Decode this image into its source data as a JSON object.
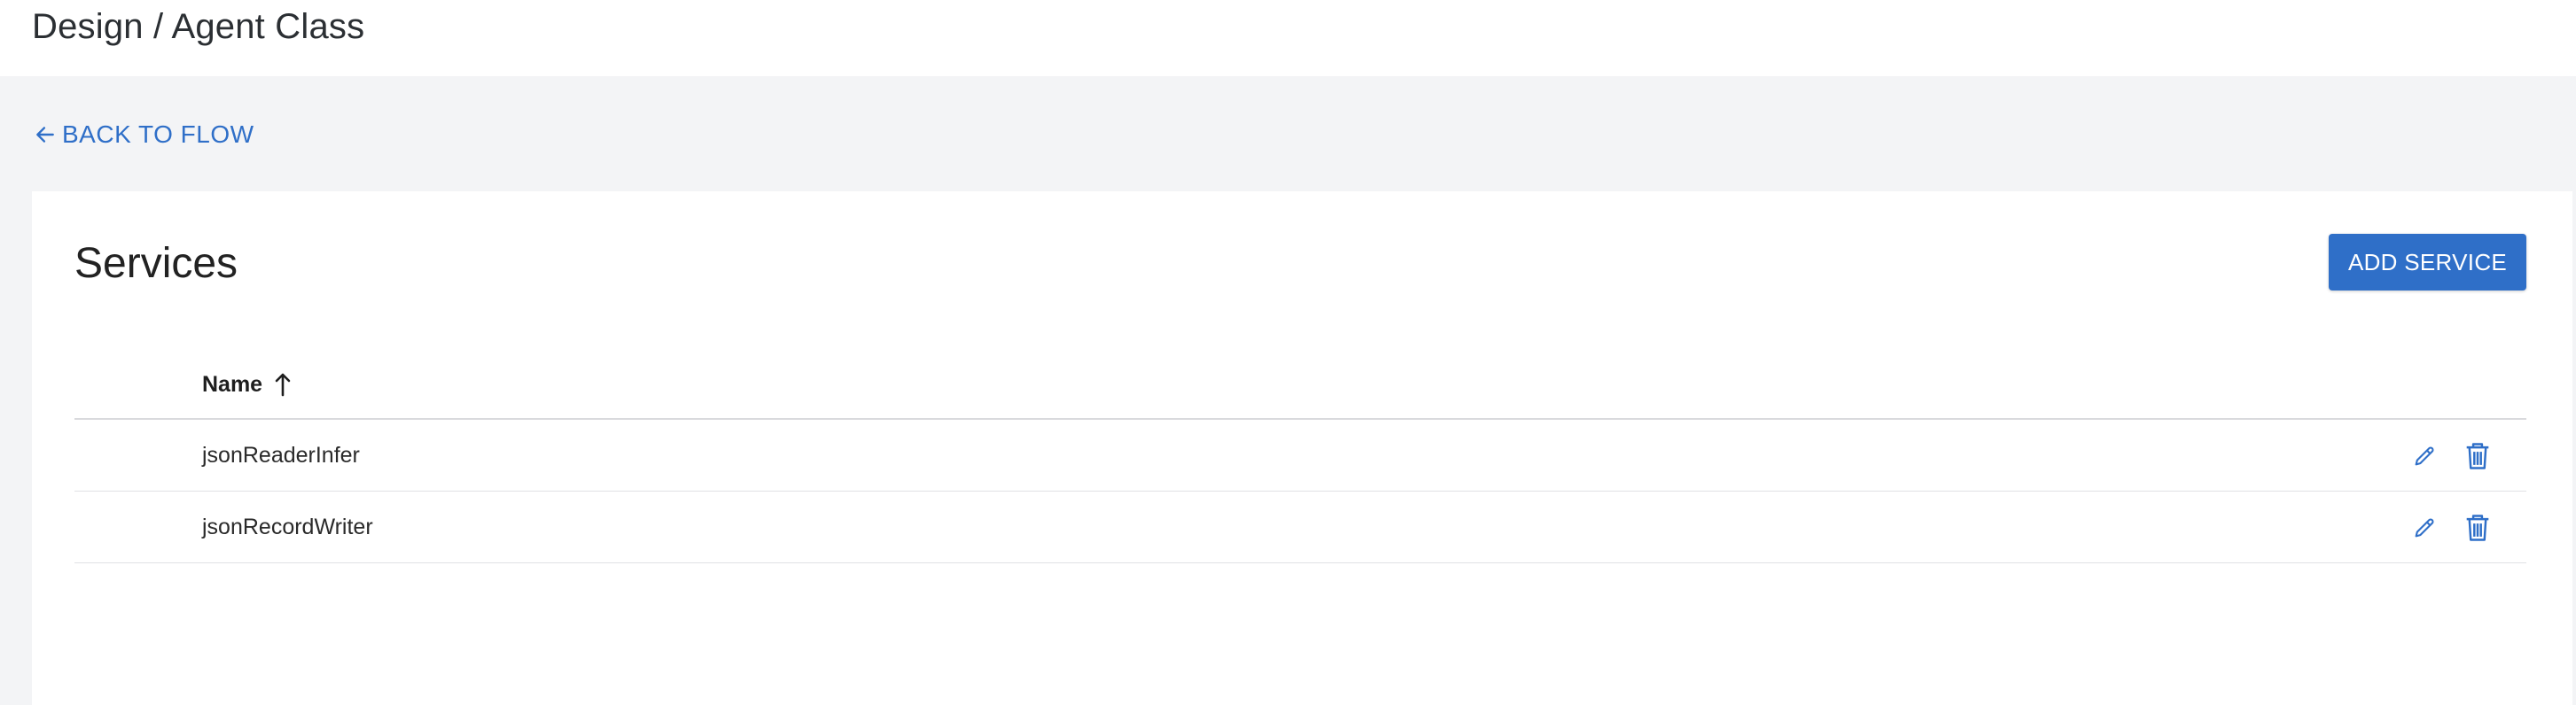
{
  "header": {
    "breadcrumb": "Design / Agent Class"
  },
  "nav": {
    "back_label": "BACK TO FLOW"
  },
  "services": {
    "title": "Services",
    "add_button_label": "ADD SERVICE",
    "columns": [
      {
        "label": "Name",
        "sort": "ascending"
      }
    ],
    "rows": [
      {
        "name": "jsonReaderInfer",
        "actions": [
          "edit",
          "delete"
        ]
      },
      {
        "name": "jsonRecordWriter",
        "actions": [
          "edit",
          "delete"
        ]
      }
    ]
  },
  "icons": {
    "back": "arrow-left-icon",
    "sort": "arrow-up-icon",
    "edit": "pencil-icon",
    "delete": "trash-icon"
  },
  "colors": {
    "accent": "#2f6fc8",
    "page_background": "#f3f4f6",
    "card_background": "#ffffff",
    "text": "#222222"
  }
}
